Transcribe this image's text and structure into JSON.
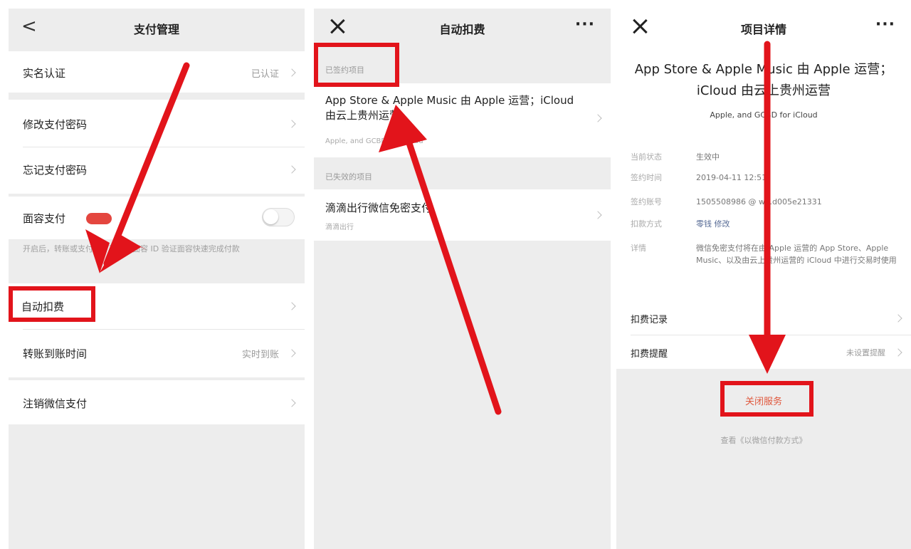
{
  "panel1": {
    "nav": {
      "back": "<",
      "title": "支付管理"
    },
    "rows": {
      "real_name": {
        "label": "实名认证",
        "value": "已认证"
      },
      "change_pwd": {
        "label": "修改支付密码"
      },
      "forgot_pwd": {
        "label": "忘记支付密码"
      },
      "face_pay": {
        "label": "面容支付",
        "helper": "开启后，转账或支付时，可使用面容 ID 验证面容快速完成付款"
      },
      "auto_deduct": {
        "label": "自动扣费"
      },
      "transfer_time": {
        "label": "转账到账时间",
        "value": "实时到账"
      },
      "cancel_pay": {
        "label": "注销微信支付"
      }
    }
  },
  "panel2": {
    "nav": {
      "title": "自动扣费"
    },
    "section_active": "已签约项目",
    "item_apple": {
      "title": "App Store & Apple Music 由 Apple 运营；iCloud 由云上贵州运营",
      "sub": "Apple, and GCBD for iCloud"
    },
    "section_expired": "已失效的项目",
    "item_didi": {
      "title": "滴滴出行微信免密支付",
      "sub": "滴滴出行"
    }
  },
  "panel3": {
    "nav": {
      "title": "项目详情"
    },
    "title_line1": "App Store & Apple Music 由 Apple 运营；",
    "title_line2": "iCloud 由云上贵州运营",
    "subtitle": "Apple, and GCBD for iCloud",
    "details": [
      {
        "label": "当前状态",
        "value": "生效中",
        "link": false
      },
      {
        "label": "签约时间",
        "value": "2019-04-11 12:51",
        "link": false
      },
      {
        "label": "签约账号",
        "value": "1505508986 @ wx.d005e21331",
        "link": false
      },
      {
        "label": "扣款方式",
        "value": "零钱 修改",
        "link": true
      },
      {
        "label": "详情",
        "value": "微信免密支付将在由 Apple 运营的 App Store、Apple Music、以及由云上贵州运营的 iCloud 中进行交易时使用",
        "link": false
      }
    ],
    "rows": {
      "records": {
        "label": "扣费记录"
      },
      "reminder": {
        "label": "扣费提醒",
        "value": "未设置提醒"
      }
    },
    "close_button": "关闭服务",
    "footer": "查看《以微信付款方式》"
  },
  "colors": {
    "annotation_red": "#e2141b",
    "close_text": "#e0573c",
    "toggle_badge": "#e4463f",
    "link_blue": "#576b95",
    "page_bg": "#ededed"
  }
}
